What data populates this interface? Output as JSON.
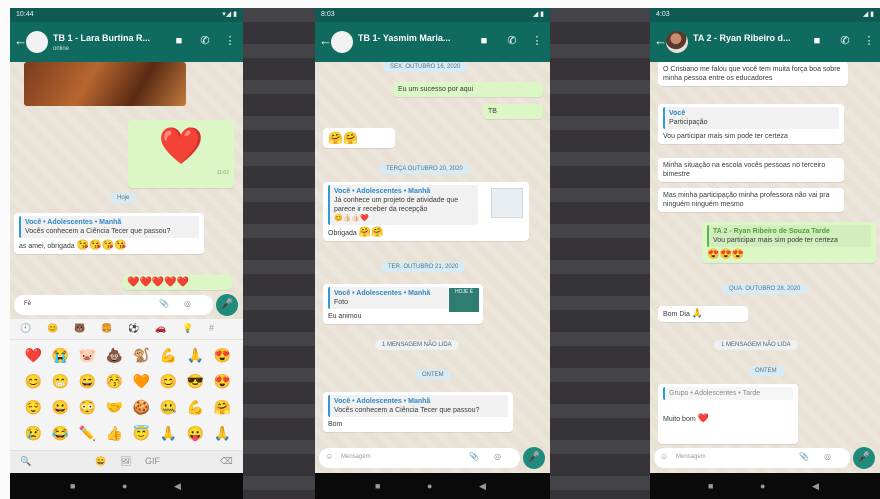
{
  "screens": [
    {
      "status_time": "10:44",
      "status_icons": "▾◢ ▮",
      "contact_name": "TB 1 - Lara Burtina R...",
      "contact_sub": "online",
      "heart_emoji": "❤️",
      "bubble_time_heart": "11:02",
      "date_pill": "Hoje",
      "quote_title": "Você • Adolescentes • Manhã",
      "quote_text": "Vocês conhecem a Ciência Tecer que passou?",
      "reply_text": "as amei, obrigada",
      "reply_emojis": "😘😘😘😘",
      "hearts_row": "❤️❤️❤️❤️❤️",
      "input_value": "Fé",
      "emoji_grid": [
        "❤️",
        "😭",
        "🐷",
        "💩",
        "🐒",
        "💪",
        "🙏",
        "😍",
        "😊",
        "😁",
        "😄",
        "😚",
        "🧡",
        "😊",
        "😎",
        "😍",
        "😌",
        "😀",
        "😳",
        "🤝",
        "🍪",
        "🤐",
        "💪",
        "🤗",
        "😢",
        "😂",
        "✏️",
        "👍",
        "😇",
        "🙏",
        "😛",
        "🙏"
      ],
      "tab_icons": [
        "🕘",
        "😊",
        "🐻",
        "🍔",
        "⚽",
        "🚗",
        "💡",
        "#"
      ],
      "kb_icons": [
        "🔍",
        "😀",
        "🖼",
        "GIF",
        "⌫"
      ]
    },
    {
      "status_time": "8:03",
      "status_icons": "◢ ▮",
      "contact_name": "TB 1- Yasmim Maria...",
      "contact_sub": "",
      "top_pill": "SEX. OUTUBRO 16, 2020",
      "out_text": "Eu um sucesso por aqui",
      "out_time": "11:02",
      "out_small": "TB",
      "hugs": "🤗🤗",
      "pill2": "TERÇA OUTUBRO 20, 2020",
      "quote_title": "Você • Adolescentes • Manhã",
      "quote_text": "Já conhece um projeto de atividade que parece ir receber da recepção",
      "quote_emojis": "😊👍🏻👍🏻❤️",
      "obrigada": "Obrigada",
      "obrigada_emojis": "🤗🤗",
      "pill3": "TER. OUTUBRO 21, 2020",
      "quote2_title": "Você • Adolescentes • Manhã",
      "quote2_text": "Foto",
      "sticker": "HOJE É",
      "quote2_reply": "Eu animou",
      "unread_pill": "1 MENSAGEM NÃO LIDA",
      "today_pill": "ONTEM",
      "quote3_title": "Você • Adolescentes • Manhã",
      "quote3_text": "Vocês conhecem a Ciência Tecer que passou?",
      "quote3_reply": "Bom",
      "input_placeholder": "Mensagem"
    },
    {
      "status_time": "4:03",
      "status_icons": "◢ ▮",
      "contact_name": "TA 2 - Ryan Ribeiro d...",
      "contact_sub": "",
      "in1": "O Cristiano me falou que você tem muita força boa sobre minha pessoa entre os educadores",
      "quote_title": "Você",
      "quote_text": "Participação",
      "reply1": "Vou participar mais sim pode ter certeza",
      "in2": "Minha situação na escola vocês pessoas no terceiro bimestre",
      "in3": "Mas minha participação minha professora não vai pra ninguém ninguém mesmo",
      "out_quote_title": "TA 2 - Ryan Ribeiro de Souza Tarde",
      "out_quote_text": "Vou participar mais sim pode ter certeza",
      "out_emojis": "😍😍😍",
      "date_pill": "QUA. OUTUBRO 28, 2020",
      "bom_dia": "Bom Dia",
      "bom_dia_emoji": "🙏",
      "unread_pill": "1 MENSAGEM NÃO LIDA",
      "yesterday_pill": "ONTEM",
      "quote2_title": "Grupo • Adolescentes • Tarde",
      "quote2_reply": "Muito bom",
      "quote2_emoji": "❤️",
      "input_placeholder": "Mensagem"
    }
  ],
  "colors": {
    "header": "#0f6a5f",
    "status": "#0f5a52",
    "outgoing": "#dcf6c5",
    "incoming": "#ffffff",
    "mic": "#1f8b7c",
    "chat_bg": "#e9e1d6"
  }
}
